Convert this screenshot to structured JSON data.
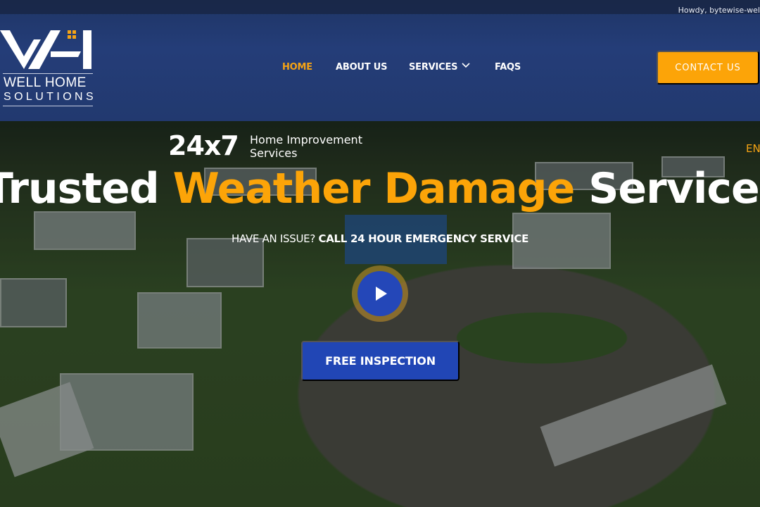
{
  "admin_bar": {
    "howdy_text": "Howdy, bytewise-wel"
  },
  "logo": {
    "line1": "WELL HOME",
    "line2": "SOLUTIONS",
    "accent_color": "#f5a314"
  },
  "nav": {
    "items": [
      {
        "label": "HOME",
        "active": true
      },
      {
        "label": "ABOUT US",
        "active": false
      },
      {
        "label": "SERVICES",
        "active": false,
        "has_dropdown": true
      },
      {
        "label": "FAQS",
        "active": false
      }
    ],
    "contact_label": "CONTACT US"
  },
  "hero": {
    "tagline_number": "24x7",
    "tagline_text_line1": "Home Improvement",
    "tagline_text_line2": "Services",
    "language_label": "EN",
    "headline_part1": "Trusted ",
    "headline_accent": "Weather Damage",
    "headline_part2": " Services",
    "subline_regular": "HAVE AN ISSUE? ",
    "subline_bold": "CALL 24 HOUR EMERGENCY SERVICE",
    "play_icon": "play-icon",
    "cta_label": "FREE INSPECTION"
  },
  "colors": {
    "brand_orange": "#fca408",
    "brand_blue": "#2146b5",
    "header_blue": "#243d78"
  }
}
